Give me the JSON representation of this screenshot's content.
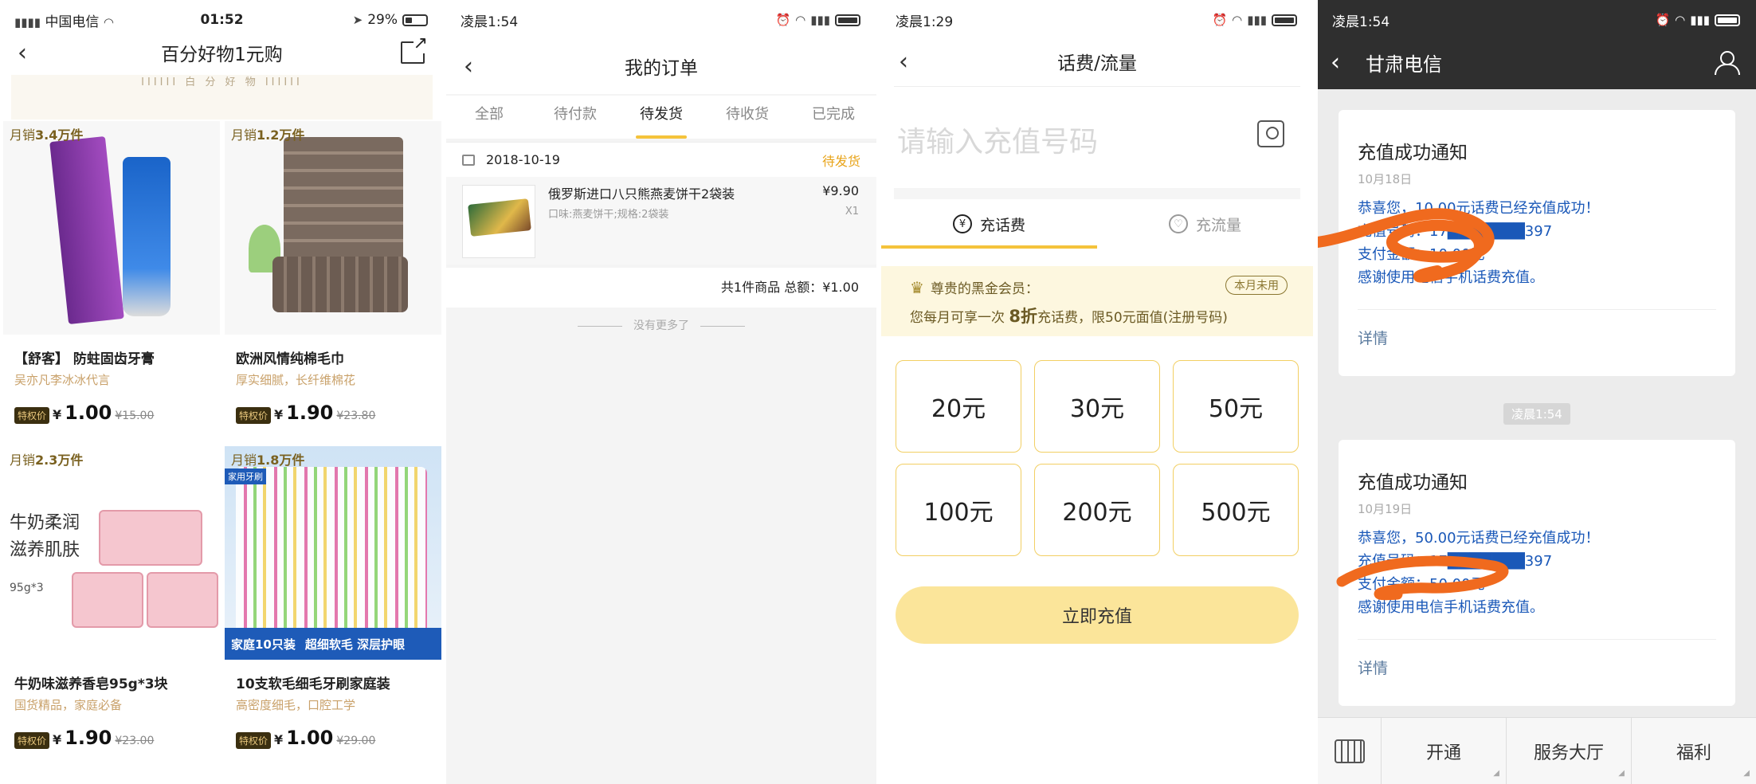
{
  "panel1": {
    "status": {
      "carrier": "中国电信",
      "time": "01:52",
      "battery": "29%"
    },
    "title": "百分好物1元购",
    "banner_text": "IIIIII 白 分 好 物 IIIIII",
    "price_tag": "特权价",
    "currency": "¥",
    "products": [
      {
        "sales_prefix": "月销",
        "sales": "3.4万件",
        "name": "【舒客】 防蛀固齿牙膏",
        "sub": "吴亦凡李冰冰代言",
        "price": "1.00",
        "old_price": "¥15.00"
      },
      {
        "sales_prefix": "月销",
        "sales": "1.2万件",
        "name": "欧洲风情纯棉毛巾",
        "sub": "厚实细腻，长纤维棉花",
        "price": "1.90",
        "old_price": "¥23.80"
      },
      {
        "sales_prefix": "月销",
        "sales": "2.3万件",
        "name": "牛奶味滋养香皂95g*3块",
        "sub": "国货精品，家庭必备",
        "price": "1.90",
        "old_price": "¥23.00",
        "image_text": [
          "牛奶柔润",
          "滋养肌肤"
        ],
        "image_sub": "95g*3"
      },
      {
        "sales_prefix": "月销",
        "sales": "1.8万件",
        "name": "10支软毛细毛牙刷家庭装",
        "sub": "高密度细毛，口腔工学",
        "price": "1.00",
        "old_price": "¥29.00",
        "image_corner": "家用牙刷",
        "image_banner": [
          "家庭10只装",
          "超细软毛 深层护眼"
        ]
      }
    ]
  },
  "panel2": {
    "status": {
      "time": "凌晨1:54"
    },
    "title": "我的订单",
    "tabs": [
      "全部",
      "待付款",
      "待发货",
      "待收货",
      "已完成"
    ],
    "active_tab": 2,
    "order": {
      "date": "2018-10-19",
      "status": "待发货",
      "item_name": "俄罗斯进口八只熊燕麦饼干2袋装",
      "item_spec": "口味:燕麦饼干;规格:2袋装",
      "item_price": "¥9.90",
      "item_qty": "X1",
      "total": "共1件商品 总额：¥1.00"
    },
    "no_more": "没有更多了"
  },
  "panel3": {
    "status": {
      "time": "凌晨1:29"
    },
    "title": "话费/流量",
    "input_placeholder": "请输入充值号码",
    "tabs": [
      "充话费",
      "充流量"
    ],
    "tab_icons": [
      "¥",
      "♡"
    ],
    "vip": {
      "line1": "尊贵的黑金会员：",
      "line2_prefix": "您每月可享一次",
      "discount": "8折",
      "line2_suffix": "充话费，限50元面值(注册号码)",
      "badge": "本月未用"
    },
    "amounts": [
      "20元",
      "30元",
      "50元",
      "100元",
      "200元",
      "500元"
    ],
    "pay_button": "立即充值",
    "accent_color": "#f5c33b"
  },
  "panel4": {
    "status": {
      "time": "凌晨1:54"
    },
    "title": "甘肃电信",
    "messages": [
      {
        "title": "充值成功通知",
        "date": "10月18日",
        "lines": [
          "恭喜您，10.00元话费已经充值成功！",
          "充值号码：17███████397",
          "支付金额：10.00元",
          "感谢使用电信手机话费充值。"
        ],
        "detail": "详情"
      },
      {
        "title": "充值成功通知",
        "date": "10月19日",
        "lines": [
          "恭喜您，50.00元话费已经充值成功！",
          "充值号码：17███████397",
          "支付金额：50.00元",
          "感谢使用电信手机话费充值。"
        ],
        "detail": "详情"
      }
    ],
    "time_chip": "凌晨1:54",
    "menu": [
      "开通",
      "服务大厅",
      "福利"
    ],
    "scribble_color": "#f06a1e"
  }
}
